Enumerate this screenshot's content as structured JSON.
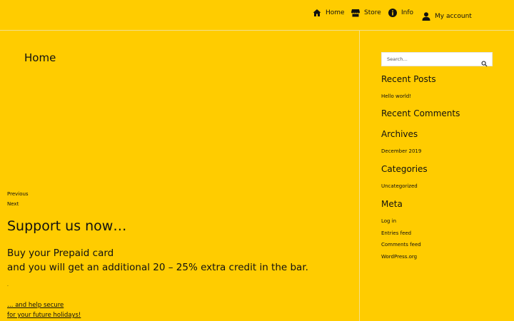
{
  "nav": {
    "home": "Home",
    "store": "Store",
    "info": "Info",
    "account": "My account"
  },
  "main": {
    "page_title": "Home",
    "previous": "Previous",
    "next": "Next",
    "support_heading": "Support us now…",
    "prepaid_line1": "Buy your Prepaid card",
    "prepaid_line2": "and you will get an additional 20 – 25% extra credit in the bar.",
    "dot": ".",
    "secure_line1": "… and help secure",
    "secure_line2": "for your future holidays!"
  },
  "sidebar": {
    "search_placeholder": "Search…",
    "recent_posts_title": "Recent Posts",
    "recent_posts": [
      "Hello world!"
    ],
    "recent_comments_title": "Recent Comments",
    "archives_title": "Archives",
    "archives": [
      "December 2019"
    ],
    "categories_title": "Categories",
    "categories": [
      "Uncategorized"
    ],
    "meta_title": "Meta",
    "meta": [
      "Log in",
      "Entries feed",
      "Comments feed",
      "WordPress.org"
    ]
  },
  "colors": {
    "background": "#ffcc00",
    "text": "#111111",
    "divider": "#f2e08a"
  },
  "icons": {
    "home": "home-icon",
    "store": "store-icon",
    "info": "info-icon",
    "account": "user-icon",
    "search": "search-icon"
  }
}
